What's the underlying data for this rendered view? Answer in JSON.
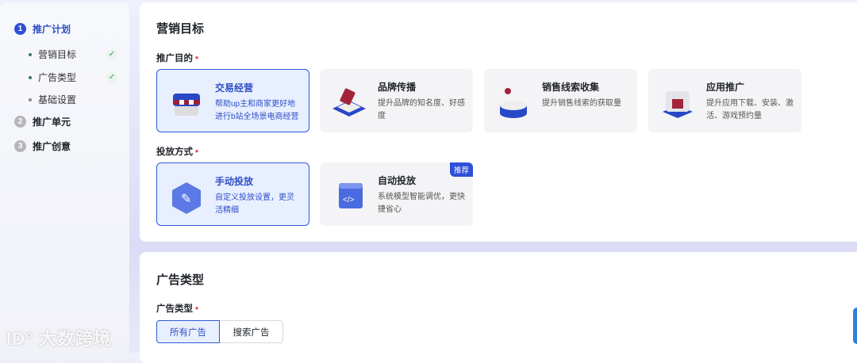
{
  "sidebar": {
    "steps": [
      {
        "num": "1",
        "label": "推广计划",
        "active": true
      },
      {
        "num": "2",
        "label": "推广单元",
        "active": false
      },
      {
        "num": "3",
        "label": "推广创意",
        "active": false
      }
    ],
    "substeps": [
      {
        "label": "营销目标",
        "done": true,
        "check": "✓"
      },
      {
        "label": "广告类型",
        "done": true,
        "check": "✓"
      },
      {
        "label": "基础设置",
        "done": false
      }
    ]
  },
  "marketing": {
    "title": "营销目标",
    "purpose_label": "推广目的",
    "required": "•",
    "purposes": [
      {
        "title": "交易经营",
        "desc": "帮助up主和商家更好地进行b站全场景电商经营",
        "icon": "shop-box-icon",
        "selected": true
      },
      {
        "title": "品牌传播",
        "desc": "提升品牌的知名度、好感度",
        "icon": "brand-tag-icon",
        "selected": false
      },
      {
        "title": "销售线索收集",
        "desc": "提升销售线索的获取量",
        "icon": "lead-collect-icon",
        "selected": false
      },
      {
        "title": "应用推广",
        "desc": "提升应用下载、安装、激活、游戏预约量",
        "icon": "app-cube-icon",
        "selected": false
      }
    ],
    "delivery_label": "投放方式",
    "delivery": [
      {
        "title": "手动投放",
        "desc": "自定义投放设置，更灵活精细",
        "icon": "wrench-icon",
        "selected": true
      },
      {
        "title": "自动投放",
        "desc": "系统模型智能调优，更快捷省心",
        "icon": "code-window-icon",
        "selected": false,
        "badge": "推荐"
      }
    ]
  },
  "adtype": {
    "title": "广告类型",
    "label": "广告类型",
    "options": [
      "所有广告",
      "搜索广告"
    ],
    "selected": "所有广告"
  },
  "watermark": "大数跨境",
  "colors": {
    "accent": "#2e4fd8",
    "required": "#e5484d",
    "success": "#3a9b5b"
  }
}
